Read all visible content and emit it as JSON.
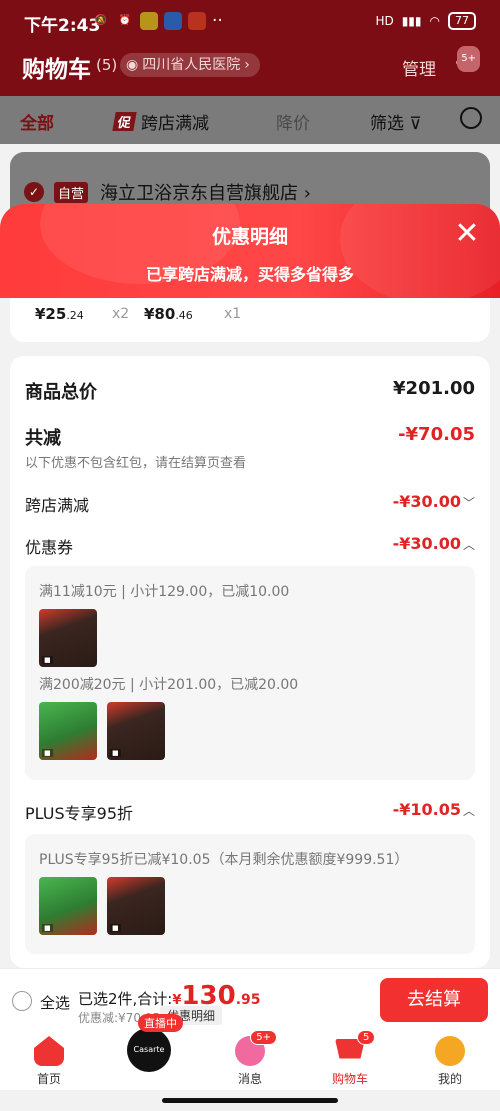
{
  "status_bar": {
    "time": "下午2:43",
    "battery": "77",
    "network": "HD"
  },
  "header": {
    "title": "购物车",
    "count": "(5)",
    "address": "四川省人民医院",
    "manage_label": "管理",
    "more_badge": "5+"
  },
  "tabs": {
    "all": "全部",
    "cross_store_badge": "促",
    "cross_store": "跨店满减",
    "price_drop": "降价",
    "filter": "筛选"
  },
  "store": {
    "badge": "自营",
    "name": "海立卫浴京东自营旗舰店"
  },
  "modal": {
    "title": "优惠明细",
    "subtitle": "已享跨店满减，买得多省得多",
    "items": [
      {
        "price_int": "¥25",
        "price_dec": ".24",
        "qty": "x2"
      },
      {
        "price_int": "¥80",
        "price_dec": ".46",
        "qty": "x1"
      }
    ],
    "total_label": "商品总价",
    "total_value": "¥201.00",
    "discount_label": "共减",
    "discount_value": "-¥70.05",
    "discount_note": "以下优惠不包含红包，请在结算页查看",
    "cross_label": "跨店满减",
    "cross_value": "-¥30.00",
    "coupon_label": "优惠券",
    "coupon_value": "-¥30.00",
    "coupon_rules": [
      "满11减10元 | 小计129.00，已减10.00",
      "满200减20元 | 小计201.00，已减20.00"
    ],
    "plus_label": "PLUS专享95折",
    "plus_value": "-¥10.05",
    "plus_rule": "PLUS专享95折已减¥10.05（本月剩余优惠额度¥999.51）"
  },
  "checkout": {
    "select_all": "全选",
    "selected_text": "已选2件,合计:",
    "currency": "¥",
    "total_int": "130",
    "total_dec": ".95",
    "discount_line": "优惠减:¥70.05",
    "detail_chip": "优惠明细",
    "button": "去结算"
  },
  "nav": {
    "home": "首页",
    "live_badge": "直播中",
    "live_brand": "Casarte",
    "messages": "消息",
    "messages_badge": "5+",
    "cart": "购物车",
    "cart_badge": "5",
    "mine": "我的"
  }
}
